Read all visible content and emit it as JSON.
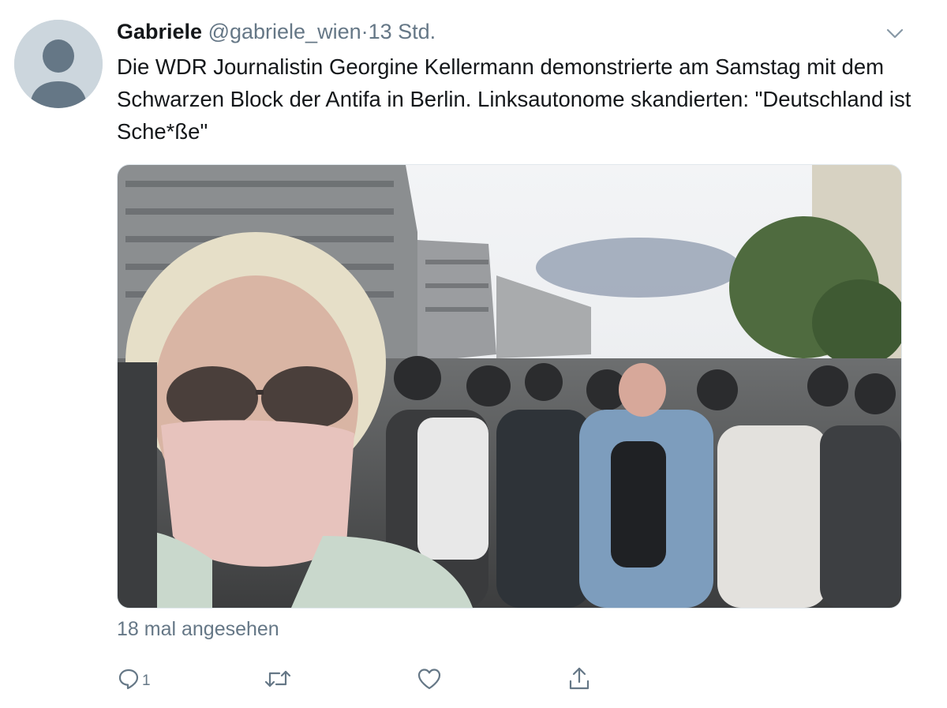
{
  "tweet": {
    "display_name": "Gabriele",
    "handle": "@gabriele_wien",
    "separator": "·",
    "time": "13 Std.",
    "text": "Die WDR Journalistin Georgine Kellermann demonstrierte am Samstag mit dem Schwarzen Block der Antifa in Berlin. Linksautonome skandierten: \"Deutschland ist Sche*ße\"",
    "views": "18 mal angesehen"
  },
  "actions": {
    "reply_count": "1",
    "retweet_count": "",
    "like_count": ""
  },
  "icons": {
    "avatar": "default-avatar-icon",
    "menu": "chevron-down-icon",
    "reply": "reply-icon",
    "retweet": "retweet-icon",
    "like": "heart-icon",
    "share": "share-icon"
  },
  "colors": {
    "text": "#14171a",
    "secondary": "#657786",
    "avatar_bg": "#ccd6dd",
    "avatar_fg": "#657786"
  }
}
